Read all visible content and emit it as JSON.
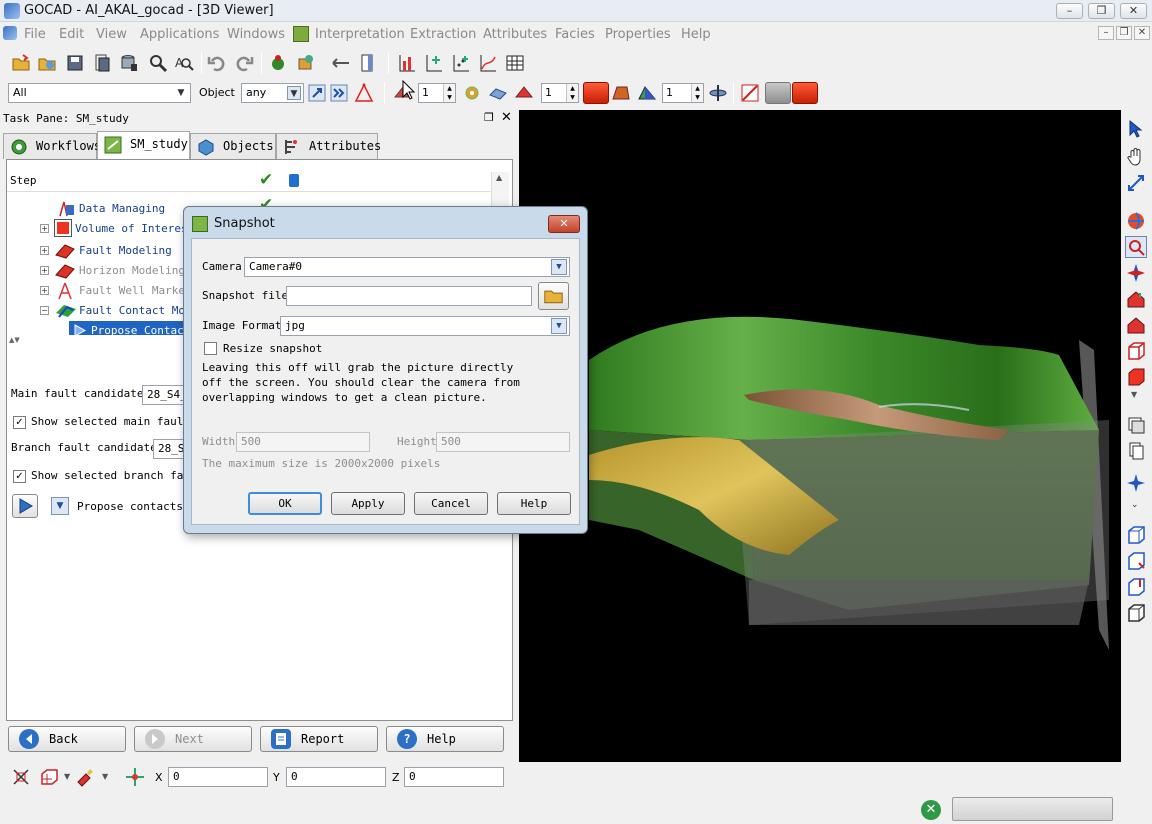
{
  "window": {
    "title": "GOCAD - AI_AKAL_gocad  - [3D Viewer]"
  },
  "menu": [
    "File",
    "Edit",
    "View",
    "Applications",
    "Windows",
    "Interpretation",
    "Extraction",
    "Attributes",
    "Facies",
    "Properties",
    "Help"
  ],
  "toolbar": {
    "filter_value": "All",
    "object_label": "Object",
    "object_value": "any",
    "spin1": "1",
    "spin2": "1",
    "spin3": "1"
  },
  "taskpane": {
    "title": "Task Pane: SM_study",
    "tabs": [
      {
        "label": "Workflows",
        "icon": "gear-icon"
      },
      {
        "label": "SM_study",
        "icon": "study-icon",
        "active": true
      },
      {
        "label": "Objects",
        "icon": "cube-icon"
      },
      {
        "label": "Attributes",
        "icon": "attributes-icon"
      }
    ],
    "tree_header": "Step",
    "tree": [
      {
        "label": "Data Managing",
        "done": true,
        "grey": false
      },
      {
        "label": "Volume of Interest",
        "done": true,
        "grey": false
      },
      {
        "label": "Fault Modeling",
        "done": false,
        "grey": false
      },
      {
        "label": "Horizon Modeling",
        "done": false,
        "grey": true
      },
      {
        "label": "Fault Well Markers",
        "done": false,
        "grey": true
      },
      {
        "label": "Fault Contact Modeling",
        "done": false,
        "grey": false
      },
      {
        "label": "Propose Contacts",
        "done": false,
        "grey": false,
        "selected": true
      }
    ],
    "main_fault_label": "Main fault candidates",
    "main_fault_value": "28_S4_",
    "show_main_label": "Show selected main fault",
    "branch_fault_label": "Branch fault candidates",
    "branch_fault_value": "28_S",
    "show_branch_label": "Show selected branch fault",
    "propose_label": "Propose contacts",
    "nav": {
      "back": "Back",
      "next": "Next",
      "report": "Report",
      "help": "Help"
    }
  },
  "bottom": {
    "x_label": "X",
    "x_value": "0",
    "y_label": "Y",
    "y_value": "0",
    "z_label": "Z",
    "z_value": "0"
  },
  "dialog": {
    "title": "Snapshot",
    "camera_label": "Camera",
    "camera_value": "Camera#0",
    "file_label": "Snapshot file",
    "file_value": "",
    "format_label": "Image Format",
    "format_value": "jpg",
    "resize_label": "Resize snapshot",
    "info_line1": "Leaving this off will grab the picture directly",
    "info_line2": "off the screen. You should clear the camera from",
    "info_line3": "overlapping windows to get a clean picture.",
    "width_label": "Width",
    "width_value": "500",
    "height_label": "Height",
    "height_value": "500",
    "max_note": "The maximum size is 2000x2000 pixels",
    "buttons": {
      "ok": "OK",
      "apply": "Apply",
      "cancel": "Cancel",
      "help": "Help"
    }
  }
}
